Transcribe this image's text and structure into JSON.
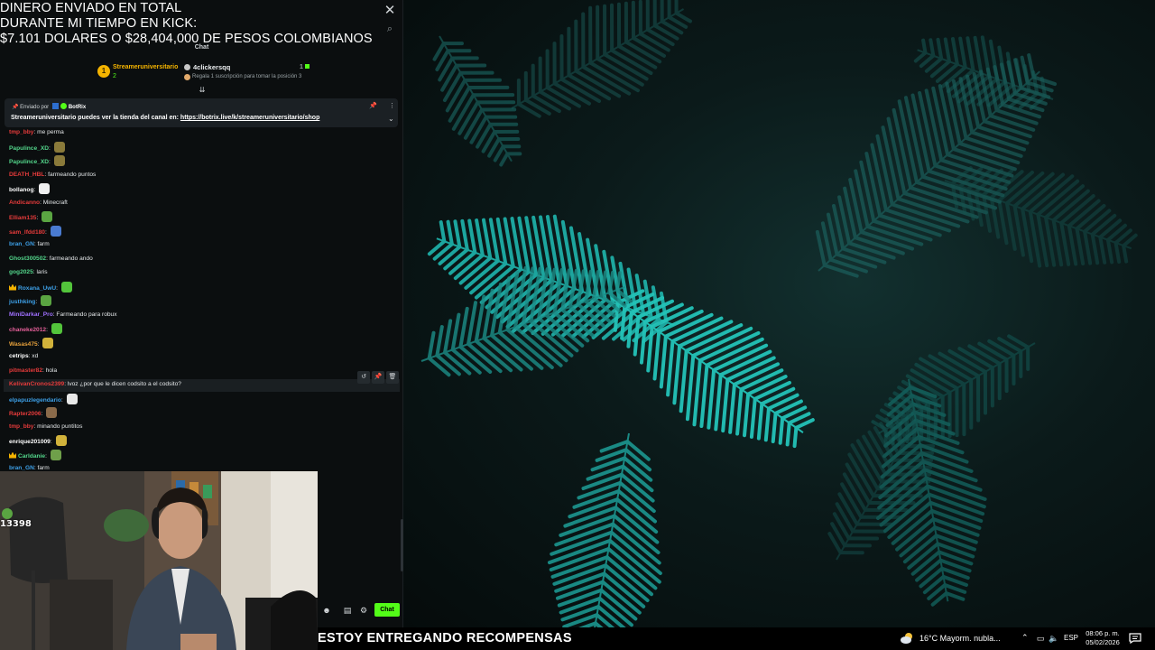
{
  "overlay_title": {
    "line1": "DINERO ENVIADO EN TOTAL",
    "line2": "DURANTE MI TIEMPO EN KICK:",
    "line3": "$7.101 DOLARES O $28,404,000 DE PESOS COLOMBIANOS"
  },
  "chat": {
    "header": "Chat",
    "leaderboard": {
      "first_name": "Streameruniversitario",
      "first_amount": "2",
      "second_name": "4clickersqq",
      "second_count": "1",
      "gift_hint": "Regala 1 suscripción para tomar la posición 3"
    },
    "pinned": {
      "sent_by_label": "Enviado por",
      "sender": "BotRix",
      "text": "Streameruniversitario puedes ver la tienda del canal en:",
      "link": "https://botrix.live/k/streameruniversitario/shop"
    },
    "messages": [
      {
        "user": "tmp_bby",
        "text": "me perma",
        "color": "#e63b3b",
        "emote": ""
      },
      {
        "user": "Papulince_XD",
        "text": "",
        "color": "#53d68b",
        "emote": "#8a7a3a"
      },
      {
        "user": "Papulince_XD",
        "text": "",
        "color": "#53d68b",
        "emote": "#8a7a3a"
      },
      {
        "user": "DEATH_HBL",
        "text": "farmeando puntos",
        "color": "#e63b3b",
        "emote": ""
      },
      {
        "user": "bollanog",
        "text": "",
        "color": "#ffffff",
        "emote": "#f0f0f0"
      },
      {
        "user": "Andicanno",
        "text": "Minecraft",
        "color": "#e63b3b",
        "emote": ""
      },
      {
        "user": "Elliam135",
        "text": "",
        "color": "#e63b3b",
        "emote": "#5aa542"
      },
      {
        "user": "sam_lfdd180",
        "text": "",
        "color": "#e63b3b",
        "emote": "#4a7bd1"
      },
      {
        "user": "bran_GN",
        "text": "farm",
        "color": "#3da0e8",
        "emote": ""
      },
      {
        "user": "Ghost300502",
        "text": "farmeando ando",
        "color": "#53d68b",
        "emote": ""
      },
      {
        "user": "gog2025",
        "text": "laris",
        "color": "#53d68b",
        "emote": ""
      },
      {
        "user": "Roxana_UwU",
        "text": "",
        "color": "#3da0e8",
        "emote": "#53c43b",
        "badge": true
      },
      {
        "user": "justhking",
        "text": "",
        "color": "#3da0e8",
        "emote": "#5aa542"
      },
      {
        "user": "MiniDarkar_Pro",
        "text": "Farmeando para robux",
        "color": "#a070ff",
        "emote": ""
      },
      {
        "user": "chaneke2012",
        "text": "",
        "color": "#e6609a",
        "emote": "#53c43b"
      },
      {
        "user": "Wasas475",
        "text": "",
        "color": "#e6a03b",
        "emote": "#d1b23b"
      },
      {
        "user": "cetrips",
        "text": "xd",
        "color": "#ffffff",
        "emote": ""
      },
      {
        "user": "pitmaster82",
        "text": "hola",
        "color": "#e63b3b",
        "emote": ""
      },
      {
        "user": "KelivanCronos2399",
        "text": "lvoz ¿por que le dicen codsito a el codsito?",
        "color": "#e63b3b",
        "emote": "",
        "hover": true
      },
      {
        "user": "elpapuzlegendario",
        "text": "",
        "color": "#3da0e8",
        "emote": "#e8e8e8"
      },
      {
        "user": "Rapter2006",
        "text": "",
        "color": "#e63b3b",
        "emote": "#8a6a4a"
      },
      {
        "user": "tmp_bby",
        "text": "minando puntitos",
        "color": "#e63b3b",
        "emote": ""
      },
      {
        "user": "enrique201009",
        "text": "",
        "color": "#ffffff",
        "emote": "#d1b23b"
      },
      {
        "user": "Carldanie",
        "text": "",
        "color": "#53d68b",
        "emote": "#6fa04a",
        "badge": true
      },
      {
        "user": "bran_GN",
        "text": "farm",
        "color": "#3da0e8",
        "emote": ""
      }
    ],
    "chat_button": "Chat"
  },
  "webcam": {
    "viewer_count": "13398"
  },
  "taskbar": {
    "ticker": "ESTOY ENTREGANDO RECOMPENSAS",
    "weather": "16°C  Mayorm. nubla...",
    "language": "ESP",
    "time": "08:06 p. m.",
    "date": "05/02/2026"
  }
}
